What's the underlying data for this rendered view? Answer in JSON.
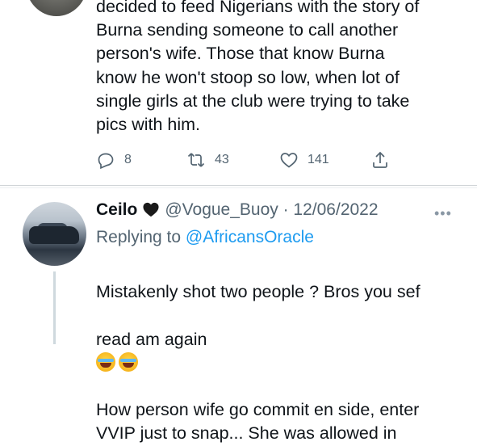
{
  "tweet1": {
    "text": "decided to feed Nigerians with the story of\nBurna sending someone to call another\nperson's wife. Those that know Burna\nknow he won't stoop so low, when lot of\nsingle girls at the club were trying to take\npics with him.",
    "replies": "8",
    "retweets": "43",
    "likes": "141"
  },
  "tweet2": {
    "name": "Ceilo",
    "handle_date": "@Vogue_Buoy · 12/06/2022",
    "replying_label": "Replying to ",
    "replying_to": "@AfricansOracle",
    "text_line1": "Mistakenly shot two people ? Bros you sef",
    "text_line2": "read am again",
    "text_rest": "How person wife go commit en side, enter\nVVIP just to snap... She was allowed in"
  },
  "icons": {
    "reply": "reply-icon",
    "retweet": "retweet-icon",
    "like": "heart-outline-icon",
    "share": "share-icon",
    "badge": "black-heart-icon",
    "more": "more-dots-icon",
    "emoji": "face-with-tears-of-joy-icon"
  },
  "colors": {
    "link": "#1d9bf0",
    "secondary": "#536471",
    "text": "#0f1419"
  }
}
